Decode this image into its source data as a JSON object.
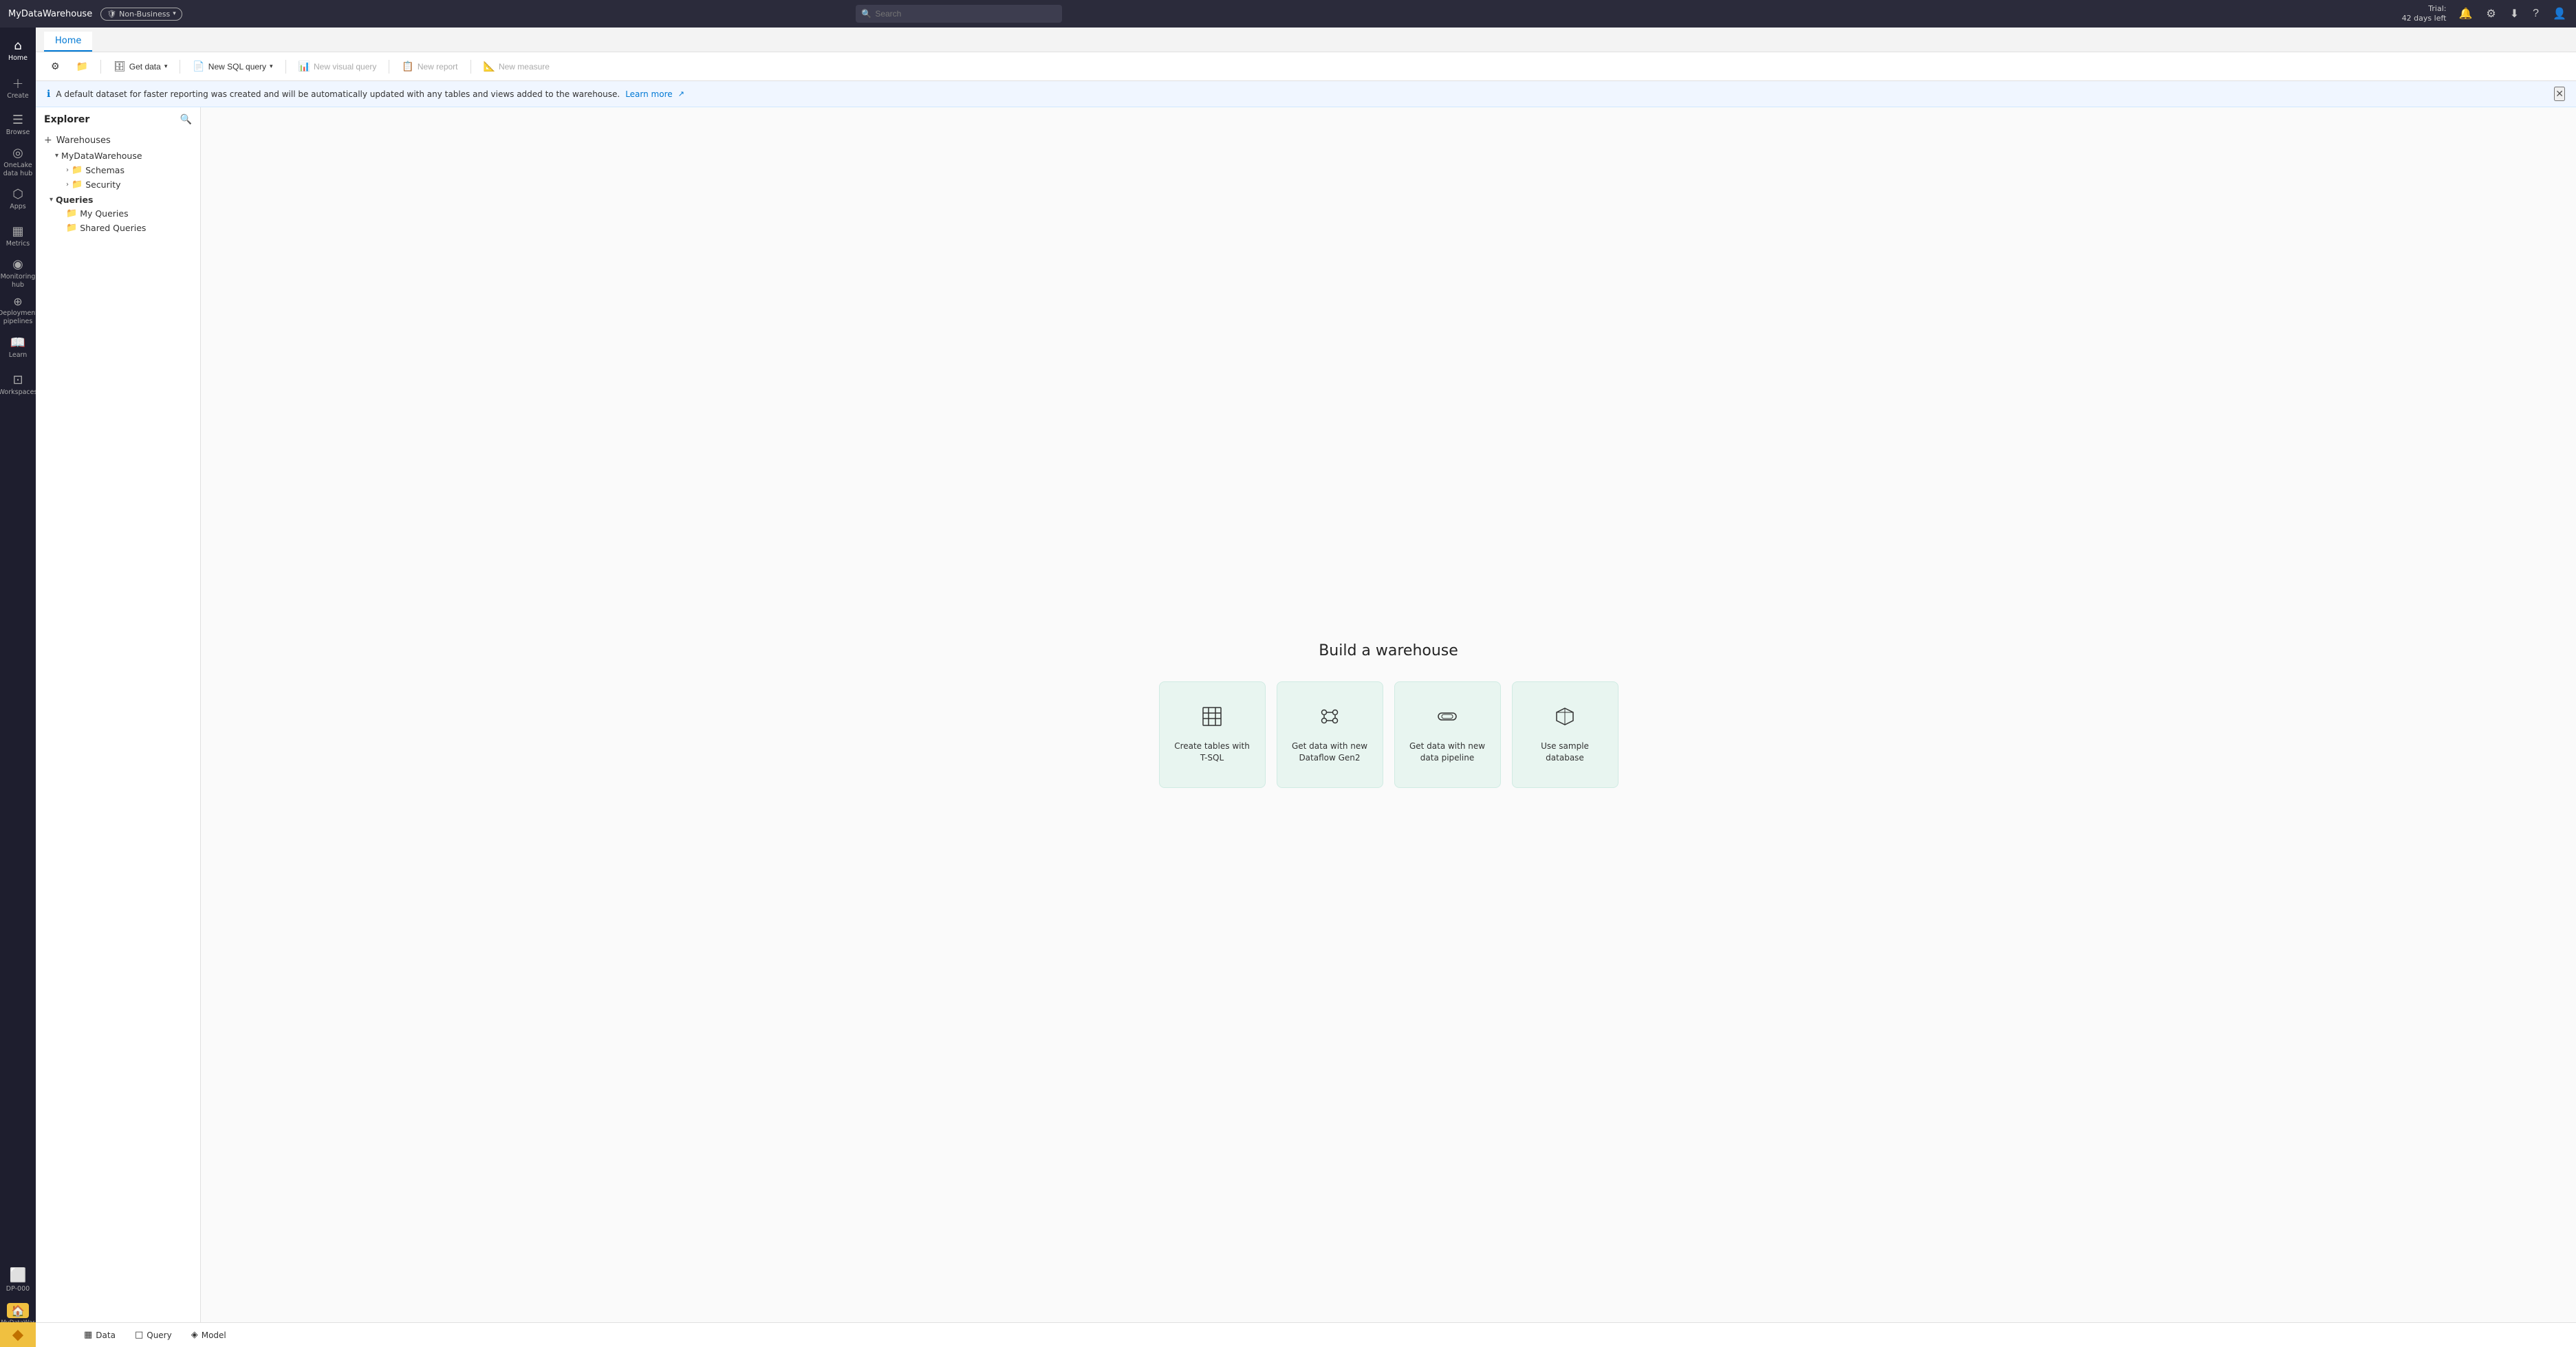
{
  "topbar": {
    "app_name": "MyDataWarehouse",
    "badge_label": "Non-Business",
    "search_placeholder": "Search",
    "trial_line1": "Trial:",
    "trial_line2": "42 days left"
  },
  "tabs": [
    {
      "id": "home",
      "label": "Home",
      "active": true
    }
  ],
  "toolbar": {
    "get_data": "Get data",
    "new_sql_query": "New SQL query",
    "new_visual_query": "New visual query",
    "new_report": "New report",
    "new_measure": "New measure",
    "settings_tooltip": "Settings",
    "folder_tooltip": "Folder"
  },
  "info_banner": {
    "message": "A default dataset for faster reporting was created and will be automatically updated with any tables and views added to the warehouse.",
    "link_text": "Learn more"
  },
  "explorer": {
    "title": "Explorer",
    "root_label": "Warehouses",
    "tree": [
      {
        "id": "mydatawarehouse",
        "label": "MyDataWarehouse",
        "level": 0,
        "type": "expanded",
        "icon": "chevron-down"
      },
      {
        "id": "schemas",
        "label": "Schemas",
        "level": 1,
        "type": "collapsed",
        "icon": "chevron-right"
      },
      {
        "id": "security",
        "label": "Security",
        "level": 1,
        "type": "collapsed",
        "icon": "chevron-right"
      },
      {
        "id": "queries",
        "label": "Queries",
        "level": 0,
        "type": "expanded",
        "icon": "chevron-down"
      },
      {
        "id": "my-queries",
        "label": "My Queries",
        "level": 1,
        "type": "leaf"
      },
      {
        "id": "shared-queries",
        "label": "Shared Queries",
        "level": 1,
        "type": "leaf"
      }
    ]
  },
  "main": {
    "build_title": "Build a warehouse",
    "cards": [
      {
        "id": "create-tables",
        "icon": "⊞",
        "label": "Create tables with T-SQL"
      },
      {
        "id": "dataflow",
        "icon": "⇄",
        "label": "Get data with new Dataflow Gen2"
      },
      {
        "id": "pipeline",
        "icon": "▱",
        "label": "Get data with new data pipeline"
      },
      {
        "id": "sample-db",
        "icon": "⚑",
        "label": "Use sample database"
      }
    ]
  },
  "sidebar_nav": [
    {
      "id": "home",
      "icon": "⌂",
      "label": "Home"
    },
    {
      "id": "create",
      "icon": "+",
      "label": "Create"
    },
    {
      "id": "browse",
      "icon": "☰",
      "label": "Browse"
    },
    {
      "id": "onelake",
      "icon": "◎",
      "label": "OneLake data hub"
    },
    {
      "id": "apps",
      "icon": "⬡",
      "label": "Apps"
    },
    {
      "id": "metrics",
      "icon": "▦",
      "label": "Metrics"
    },
    {
      "id": "monitoring",
      "icon": "◉",
      "label": "Monitoring hub"
    },
    {
      "id": "deployment",
      "icon": "⑆",
      "label": "Deployment pipelines"
    },
    {
      "id": "learn",
      "icon": "📖",
      "label": "Learn"
    },
    {
      "id": "workspaces",
      "icon": "⊡",
      "label": "Workspaces"
    }
  ],
  "bottom_tabs": [
    {
      "id": "data",
      "icon": "▦",
      "label": "Data"
    },
    {
      "id": "query",
      "icon": "□",
      "label": "Query"
    },
    {
      "id": "model",
      "icon": "◈",
      "label": "Model"
    }
  ],
  "powerbi_logo": "⬥"
}
